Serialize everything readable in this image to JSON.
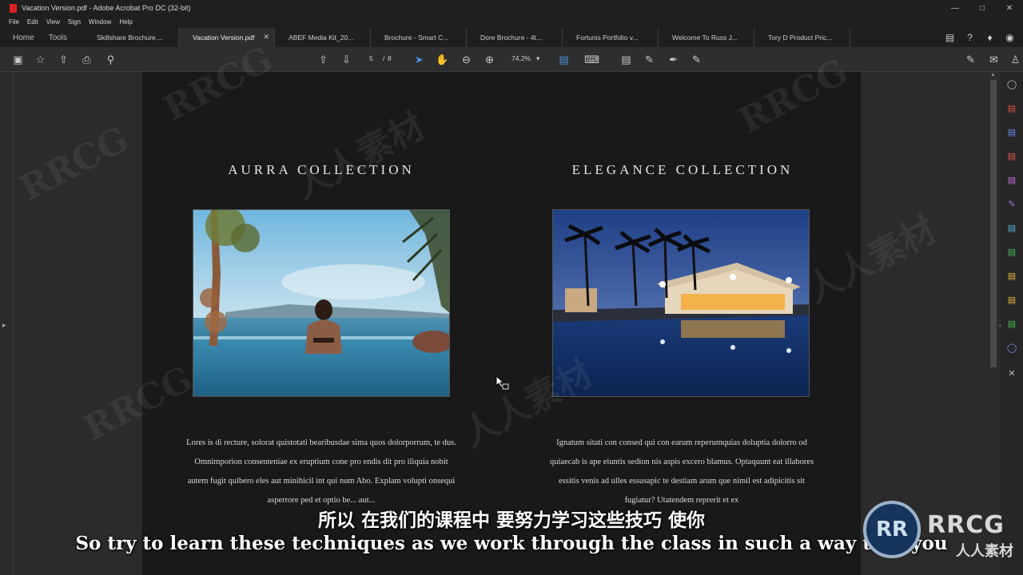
{
  "window": {
    "title": "Vacation Version.pdf - Adobe Acrobat Pro DC (32-bit)"
  },
  "menu": [
    "File",
    "Edit",
    "View",
    "Sign",
    "Window",
    "Help"
  ],
  "tabs": {
    "home": "Home",
    "tools": "Tools",
    "documents": [
      "Skillshare Brochure....",
      "Vacation Version.pdf",
      "ABEF Media Kit_20...",
      "Brochure - Smart C...",
      "Dore Brochure - 4t...",
      "Fortunis Portfolio v...",
      "Welcome To Russ J...",
      "Tory D Product Pric..."
    ],
    "active_index": 1
  },
  "toolbar": {
    "page_current": "5",
    "page_sep": "/",
    "page_total": "8",
    "zoom": "74.2%"
  },
  "document": {
    "left": {
      "title": "AURRA COLLECTION",
      "body": "Lores is di recture, solorat quistotati bearibusdae sima quos dolorporrum, te dus. Omnimporion consenteniae ex eruptium cone pro endis dit pro iliquia nobit autem fugit quibero eles aut minihicil int qui num Abo. Explam volupti onsequi asperrore ped et optio be... aut..."
    },
    "right": {
      "title": "ELEGANCE COLLECTION",
      "body": "Ignatum sitati con consed qui con earum reperumquias doluptia dolorro od quiaecab is ape eiuntis sedion nis aspis excero blamus. Optaquunt eat illabores essitis venis ad ulles essusapic te destiam arum que nimil est adipicitis sit fugiatur? Utatendem reprerit et ex"
    }
  },
  "subtitles": {
    "chinese": "所以 在我们的课程中 要努力学习这些技巧 使你",
    "english": "So try to learn these techniques as we work through the class in such a way that you"
  },
  "watermark": {
    "text": "RRCG",
    "cn_text": "人人素材"
  },
  "colors": {
    "app_bg": "#2b2b2b",
    "page_bg": "#191919",
    "accent": "#4a90e2"
  }
}
